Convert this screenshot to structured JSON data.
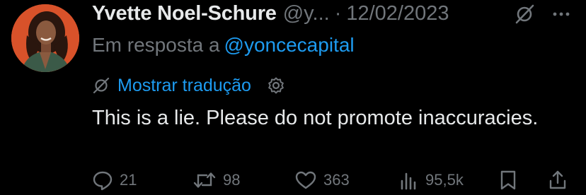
{
  "tweet": {
    "author": {
      "display_name": "Yvette Noel-Schure",
      "handle": "@y..."
    },
    "separator": "·",
    "date": "12/02/2023",
    "reply_prefix": "Em resposta a",
    "reply_to": "@yoncecapital",
    "translate_label": "Mostrar tradução",
    "text": "This is a lie. Please do not promote inaccuracies.",
    "metrics": {
      "replies": "21",
      "retweets": "98",
      "likes": "363",
      "views": "95,5k"
    },
    "icons": {
      "grok": "grok-icon",
      "more": "more-dots-icon",
      "translate": "grok-icon",
      "settings": "gear-icon",
      "reply": "speech-bubble-icon",
      "retweet": "retweet-icon",
      "like": "heart-icon",
      "views": "bar-chart-icon",
      "bookmark": "bookmark-icon",
      "share": "share-icon"
    },
    "colors": {
      "background": "#000000",
      "primary_text": "#e7e9ea",
      "secondary_text": "#71767b",
      "accent_link": "#1d9bf0",
      "avatar_bg": "#d8522a"
    }
  }
}
